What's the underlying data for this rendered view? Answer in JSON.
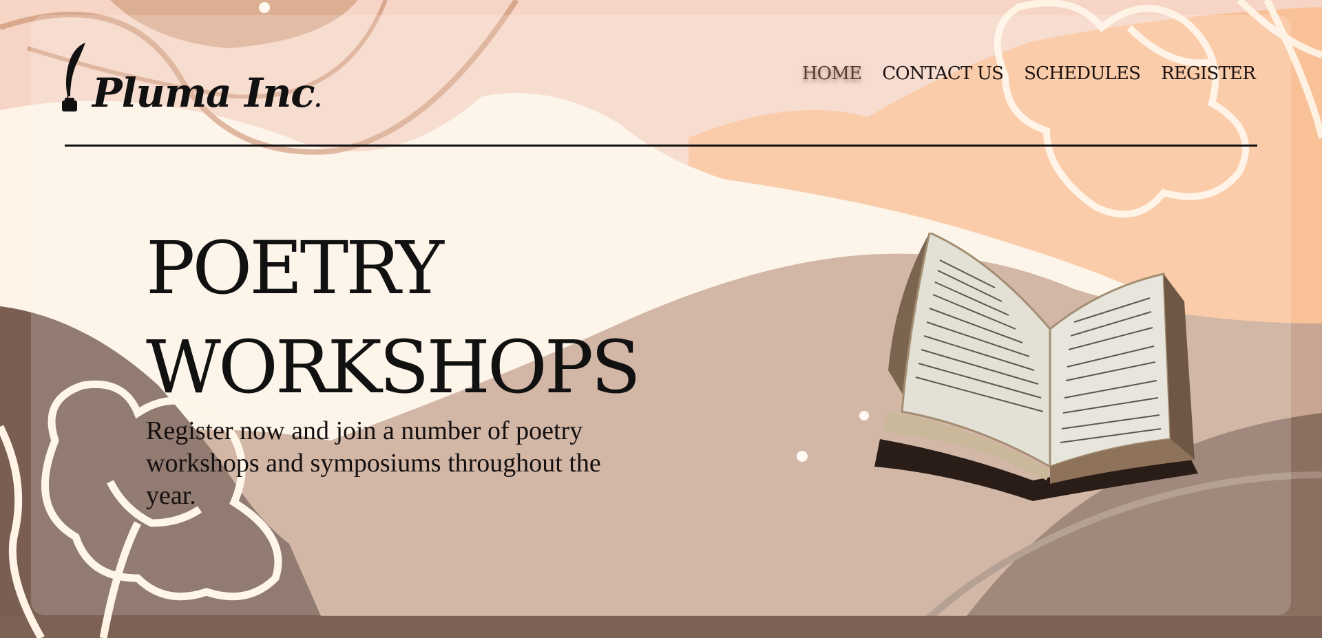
{
  "brand": {
    "name": "Pluma Inc",
    "suffix": "."
  },
  "nav": {
    "items": [
      {
        "label": "HOME",
        "active": true
      },
      {
        "label": "CONTACT US",
        "active": false
      },
      {
        "label": "SCHEDULES",
        "active": false
      },
      {
        "label": "REGISTER",
        "active": false
      }
    ]
  },
  "hero": {
    "title_line1": "POETRY",
    "title_line2": "WORKSHOPS",
    "description": "Register now and join a number of poetry workshops and symposiums throughout the year."
  },
  "colors": {
    "text": "#111111",
    "active_nav": "#5a3b31",
    "cream": "#fdf2e6",
    "peach": "#f9c197",
    "taupe": "#c9a896",
    "brown": "#7a5e52"
  },
  "icons": {
    "logo": "quill-inkwell-icon",
    "illustration": "open-book-image"
  }
}
